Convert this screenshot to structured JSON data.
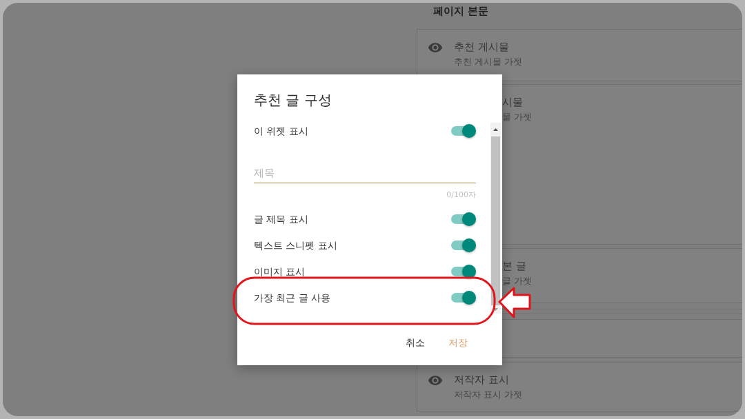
{
  "page": {
    "section_title": "페이지 본문",
    "cards": [
      {
        "kind": "gadget",
        "eye_icon": true,
        "offset": false,
        "title": "추천 게시물",
        "subtitle": "추천 게시물 가젯"
      },
      {
        "kind": "gadget",
        "eye_icon": false,
        "offset": true,
        "title": "시물",
        "subtitle": "물 가젯"
      },
      {
        "kind": "gadget",
        "eye_icon": false,
        "offset": true,
        "title": "본 글",
        "subtitle": "글 가젯"
      },
      {
        "kind": "empty"
      },
      {
        "kind": "gadget",
        "eye_icon": true,
        "offset": false,
        "title": "저작자 표시",
        "subtitle": "저작자 표시 가젯"
      }
    ]
  },
  "dialog": {
    "title": "추천 글 구성",
    "items": [
      {
        "kind": "toggle",
        "label": "이 위젯 표시",
        "on": true
      },
      {
        "kind": "textfield",
        "placeholder": "제목",
        "counter": "0/100자"
      },
      {
        "kind": "toggle",
        "label": "글 제목 표시",
        "on": true
      },
      {
        "kind": "toggle",
        "label": "텍스트 스니펫 표시",
        "on": true
      },
      {
        "kind": "toggle",
        "label": "이미지 표시",
        "on": true
      },
      {
        "kind": "toggle",
        "label": "가장 최근 글 사용",
        "on": true
      }
    ],
    "buttons": [
      {
        "kind": "cancel",
        "label": "취소"
      },
      {
        "kind": "save",
        "label": "저장"
      }
    ]
  }
}
